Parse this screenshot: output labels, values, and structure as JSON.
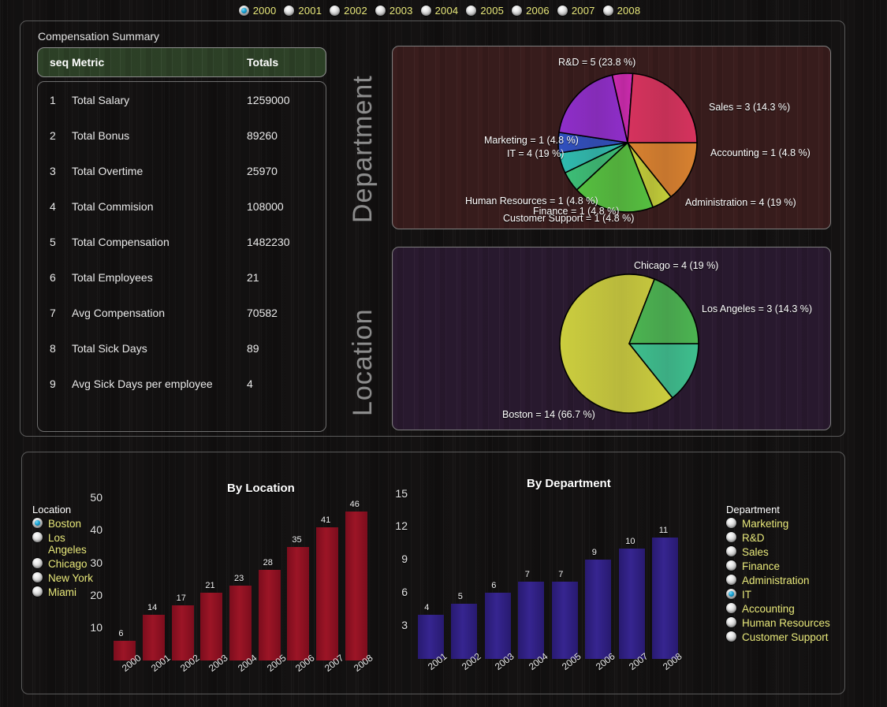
{
  "years": {
    "options": [
      "2000",
      "2001",
      "2002",
      "2003",
      "2004",
      "2005",
      "2006",
      "2007",
      "2008"
    ],
    "selected": "2000"
  },
  "summary": {
    "title": "Compensation Summary",
    "columns": [
      "seq",
      "Metric",
      "Totals"
    ],
    "rows": [
      {
        "seq": "1",
        "metric": "Total Salary",
        "total": "1259000"
      },
      {
        "seq": "2",
        "metric": "Total Bonus",
        "total": "89260"
      },
      {
        "seq": "3",
        "metric": "Total Overtime",
        "total": "25970"
      },
      {
        "seq": "4",
        "metric": "Total Commision",
        "total": "108000"
      },
      {
        "seq": "5",
        "metric": "Total Compensation",
        "total": "1482230"
      },
      {
        "seq": "6",
        "metric": "Total Employees",
        "total": "21"
      },
      {
        "seq": "7",
        "metric": "Avg Compensation",
        "total": "70582"
      },
      {
        "seq": "8",
        "metric": "Total Sick Days",
        "total": "89"
      },
      {
        "seq": "9",
        "metric": "Avg Sick Days per employee",
        "total": "4"
      }
    ]
  },
  "side_labels": {
    "department": "Department",
    "location": "Location"
  },
  "chart_data": [
    {
      "type": "pie",
      "name": "department-pie",
      "title": "Department",
      "labels": [
        "R&D = 5 (23.8 %)",
        "Sales = 3 (14.3 %)",
        "Accounting = 1 (4.8 %)",
        "Administration = 4 (19 %)",
        "Customer Support = 1 (4.8 %)",
        "Finance = 1 (4.8 %)",
        "Human Resources = 1 (4.8 %)",
        "IT = 4 (19 %)",
        "Marketing = 1 (4.8 %)"
      ],
      "categories": [
        "Sales",
        "Accounting",
        "Administration",
        "Customer Support",
        "Finance",
        "Human Resources",
        "IT",
        "Marketing",
        "R&D"
      ],
      "values": [
        3,
        1,
        4,
        1,
        1,
        1,
        4,
        1,
        5
      ],
      "percents": [
        14.3,
        4.8,
        19.0,
        4.8,
        4.8,
        4.8,
        19.0,
        4.8,
        23.8
      ],
      "colors": [
        "#d98230",
        "#c4d03a",
        "#55c040",
        "#3cbf77",
        "#2fbcb0",
        "#3050bf",
        "#8f2ecb",
        "#cd2ab0",
        "#d6335e"
      ],
      "total": 21
    },
    {
      "type": "pie",
      "name": "location-pie",
      "title": "Location",
      "labels": [
        "Chicago = 4 (19 %)",
        "Los Angeles = 3 (14.3 %)",
        "Boston = 14 (66.7 %)"
      ],
      "categories": [
        "Los Angeles",
        "Boston",
        "Chicago"
      ],
      "values": [
        3,
        14,
        4
      ],
      "percents": [
        14.3,
        66.7,
        19.0
      ],
      "colors": [
        "#3ec08e",
        "#ccce3e",
        "#4cb551"
      ],
      "total": 21
    },
    {
      "type": "bar",
      "name": "by-location-bar",
      "title": "By Location",
      "categories": [
        "2000",
        "2001",
        "2002",
        "2003",
        "2004",
        "2005",
        "2006",
        "2007",
        "2008"
      ],
      "values": [
        6,
        14,
        17,
        21,
        23,
        28,
        35,
        41,
        46
      ],
      "yticks": [
        10,
        20,
        30,
        40,
        50
      ],
      "ylim": [
        0,
        53
      ],
      "xlabel": "",
      "ylabel": "",
      "grid": false,
      "color": "#8a1022"
    },
    {
      "type": "bar",
      "name": "by-department-bar",
      "title": "By Department",
      "categories": [
        "2001",
        "2002",
        "2003",
        "2004",
        "2005",
        "2006",
        "2007",
        "2008"
      ],
      "values": [
        4,
        5,
        6,
        7,
        7,
        9,
        10,
        11
      ],
      "yticks": [
        3,
        6,
        9,
        12,
        15
      ],
      "ylim": [
        0,
        15.9
      ],
      "xlabel": "",
      "ylabel": "",
      "grid": false,
      "color": "#2e2080"
    }
  ],
  "filters": {
    "location": {
      "header": "Location",
      "options": [
        "Boston",
        "Los Angeles",
        "Chicago",
        "New York",
        "Miami"
      ],
      "selected": "Boston"
    },
    "department": {
      "header": "Department",
      "options": [
        "Marketing",
        "R&D",
        "Sales",
        "Finance",
        "Administration",
        "IT",
        "Accounting",
        "Human Resources",
        "Customer Support"
      ],
      "selected": "IT"
    }
  },
  "colors": {
    "accent_yellow": "#e8e87a",
    "table_header_green": "#2e4228",
    "dept_panel_bg": "#3a1d1d",
    "loc_panel_bg": "#2a1a30",
    "loc_bar": "#8a1022",
    "dept_bar": "#2e2080"
  }
}
